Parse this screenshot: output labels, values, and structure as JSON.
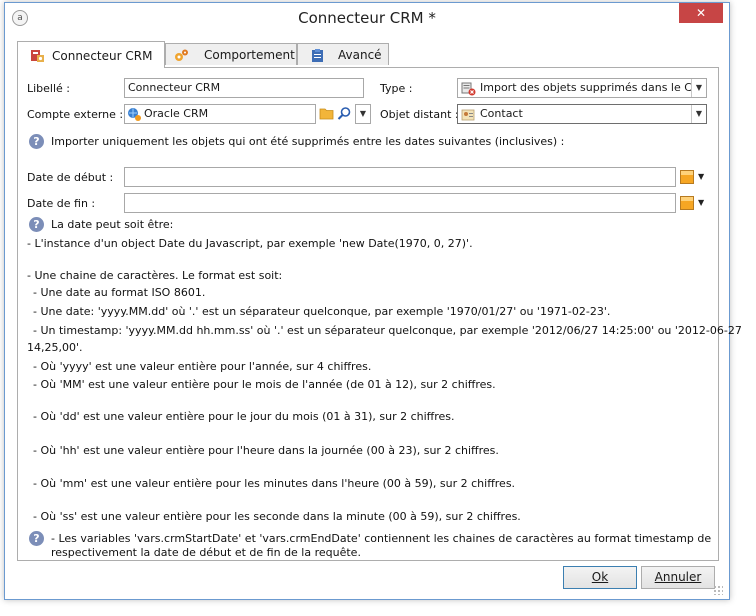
{
  "window": {
    "title": "Connecteur CRM *",
    "close_label": "✕"
  },
  "tabs": [
    {
      "label": "Connecteur CRM",
      "icon": "crm-connector-icon",
      "active": true
    },
    {
      "label": "Comportement",
      "icon": "gears-icon",
      "active": false
    },
    {
      "label": "Avancé",
      "icon": "clipboard-icon",
      "active": false
    }
  ],
  "form": {
    "libelle_label": "Libellé :",
    "libelle_value": "Connecteur CRM",
    "type_label": "Type :",
    "type_value": "Import des objets supprimés dans le CR",
    "compte_label": "Compte externe :",
    "compte_value": "Oracle CRM",
    "objet_label": "Objet distant :",
    "objet_value": "Contact"
  },
  "info_line": "Importer uniquement les objets qui ont été supprimés entre les dates suivantes (inclusives) :",
  "dates": {
    "debut_label": "Date de début :",
    "debut_value": "",
    "fin_label": "Date de fin :",
    "fin_value": ""
  },
  "help": {
    "heading": "La date peut soit être:",
    "lines": [
      "- L'instance d'un object Date du Javascript, par exemple 'new Date(1970, 0, 27)'.",
      "- Une chaine de caractères. Le format est soit:",
      "- Une date au format ISO 8601.",
      "- Une date: 'yyyy.MM.dd' où '.' est un séparateur quelconque, par exemple '1970/01/27' ou '1971-02-23'.",
      "- Un timestamp: 'yyyy.MM.dd hh.mm.ss' où '.' est un séparateur quelconque, par exemple '2012/06/27 14:25:00' ou '2012-06-27",
      "14,25,00'.",
      "- Où 'yyyy' est une valeur entière pour l'année, sur 4 chiffres.",
      "- Où 'MM' est une valeur entière pour le mois de l'année (de 01 à 12), sur 2 chiffres.",
      "- Où 'dd' est une valeur entière pour le jour du mois (01 à 31), sur 2 chiffres.",
      "- Où 'hh' est une valeur entière pour l'heure dans la journée (00 à 23), sur 2 chiffres.",
      "- Où 'mm' est une valeur entière pour les minutes dans l'heure (00 à 59), sur 2 chiffres.",
      "- Où 'ss' est une valeur entière pour les seconde dans la minute (00 à 59), sur 2 chiffres."
    ],
    "note_line1": "- Les variables 'vars.crmStartDate' et 'vars.crmEndDate' contiennent les chaines de caractères au format timestamp de",
    "note_line2": "respectivement la date de début et de fin de la requête."
  },
  "buttons": {
    "ok": "Ok",
    "cancel": "Annuler"
  },
  "colors": {
    "accent": "#6b9ad0",
    "close": "#c74545",
    "help": "#7c8eb8"
  }
}
